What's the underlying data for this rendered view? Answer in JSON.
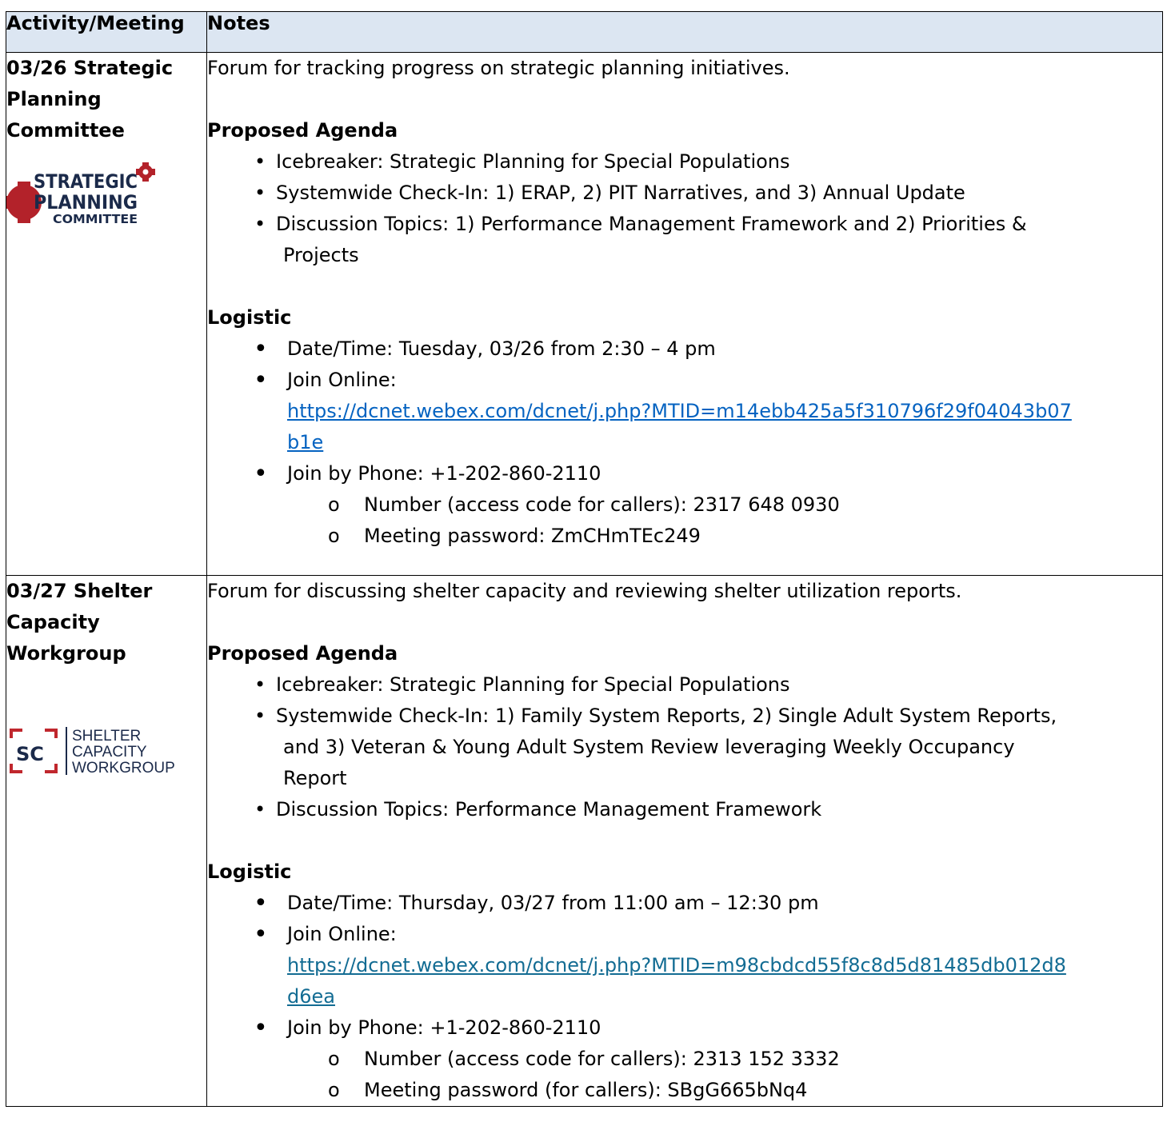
{
  "header": {
    "col1": "Activity/Meeting",
    "col2": "Notes"
  },
  "meetings": [
    {
      "title": "03/26 Strategic Planning Committee",
      "logo_lines": [
        "STRATEGIC",
        "PLANNING",
        "COMMITTEE"
      ],
      "logo_color": "#b3222a",
      "description": "Forum for tracking progress on strategic planning initiatives.",
      "agenda_heading": "Proposed Agenda",
      "agenda": [
        "Icebreaker: Strategic Planning for Special Populations",
        "Systemwide Check-In: 1) ERAP, 2) PIT Narratives, and 3) Annual Update",
        "Discussion Topics: 1) Performance Management Framework and 2) Priorities &",
        "Projects"
      ],
      "logistic_heading": "Logistic",
      "datetime": "Date/Time: Tuesday, 03/26 from 2:30 – 4 pm",
      "join_online_label": "Join Online:",
      "join_online_url_1": "https://dcnet.webex.com/dcnet/j.php?MTID=m14ebb425a5f310796f29f04043b07",
      "join_online_url_2": "b1e",
      "join_phone": "Join by Phone: +1-202-860-2110",
      "access_code": "Number (access code for callers): 2317 648 0930",
      "password": "Meeting password: ZmCHmTEc249"
    },
    {
      "title": "03/27 Shelter Capacity Workgroup",
      "logo_mark": "SC",
      "logo_lines": [
        "SHELTER",
        "CAPACITY",
        "WORKGROUP"
      ],
      "logo_color": "#c0272d",
      "description": "Forum for discussing shelter capacity and reviewing shelter utilization reports.",
      "agenda_heading": "Proposed Agenda",
      "agenda_1": "Icebreaker: Strategic Planning for Special Populations",
      "agenda_2a": "Systemwide Check-In: 1) Family System Reports, 2) Single Adult System Reports,",
      "agenda_2b": "and 3) Veteran & Young Adult System Review leveraging Weekly Occupancy",
      "agenda_2c": "Report",
      "agenda_3": "Discussion Topics: Performance Management Framework",
      "logistic_heading": "Logistic",
      "datetime": "Date/Time: Thursday, 03/27 from 11:00 am – 12:30 pm",
      "join_online_label": "Join Online:",
      "join_online_url_1": "https://dcnet.webex.com/dcnet/j.php?MTID=m98cbdcd55f8c8d5d81485db012d8",
      "join_online_url_2": "d6ea",
      "join_phone": "Join by Phone: +1-202-860-2110",
      "access_code": "Number (access code for callers): 2313 152 3332",
      "password": "Meeting password (for callers): SBgG665bNq4"
    }
  ]
}
